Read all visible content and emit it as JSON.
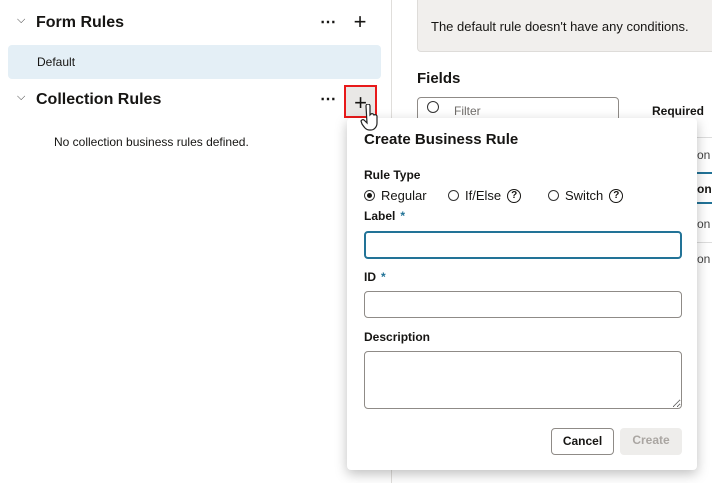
{
  "form_rules": {
    "title": "Form Rules",
    "items": [
      {
        "label": "Default"
      }
    ]
  },
  "collection_rules": {
    "title": "Collection Rules",
    "empty_text": "No collection business rules defined."
  },
  "info_message": "The default rule doesn't have any conditions.",
  "fields": {
    "title": "Fields",
    "filter_placeholder": "Filter",
    "required_header": "Required",
    "row_fragments": [
      "on",
      "on",
      "on",
      "on"
    ]
  },
  "dialog": {
    "title": "Create Business Rule",
    "rule_type_label": "Rule Type",
    "rule_types": [
      {
        "label": "Regular",
        "selected": true
      },
      {
        "label": "If/Else",
        "help": true
      },
      {
        "label": "Switch",
        "help": true
      }
    ],
    "label_field": {
      "label": "Label",
      "required_mark": "*",
      "value": ""
    },
    "id_field": {
      "label": "ID",
      "required_mark": "*",
      "value": ""
    },
    "description_field": {
      "label": "Description",
      "value": ""
    },
    "cancel_label": "Cancel",
    "create_label": "Create"
  },
  "icons": {
    "more": "⋯",
    "add": "+",
    "help": "?",
    "chevron": "⌄"
  },
  "colors": {
    "accent": "#227397",
    "selected_bg": "#e4eff6",
    "highlight_border": "#e8191a"
  }
}
